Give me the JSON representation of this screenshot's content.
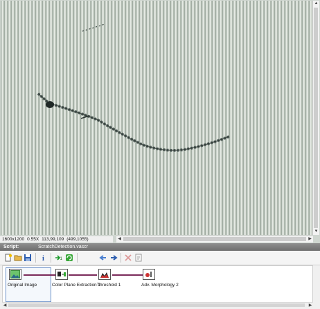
{
  "status": {
    "image_size": "1600x1200",
    "zoom": "0.55X",
    "pixel_value": "113,99,109",
    "cursor": "(499,1055)"
  },
  "script": {
    "label": "Script:",
    "filename": "ScratchDetection.vascr"
  },
  "toolbar": {
    "icons": [
      "new-script-icon",
      "open-script-icon",
      "save-script-icon",
      "info-icon",
      "run-once-icon",
      "run-continuous-icon",
      "previous-step-icon",
      "next-step-icon",
      "delete-step-icon",
      "performance-meter-icon"
    ]
  },
  "steps": [
    {
      "label": "Original Image",
      "icon": "original-image-icon"
    },
    {
      "label": "Color Plane Extraction 1",
      "icon": "color-plane-extraction-icon"
    },
    {
      "label": "Threshold 1",
      "icon": "threshold-icon"
    },
    {
      "label": "Adv. Morphology 2",
      "icon": "advanced-morphology-icon"
    }
  ],
  "colors": {
    "script_bar": "#7a7a7a",
    "selection": "#6a8fc7",
    "link_line": "#7a2a5a"
  }
}
